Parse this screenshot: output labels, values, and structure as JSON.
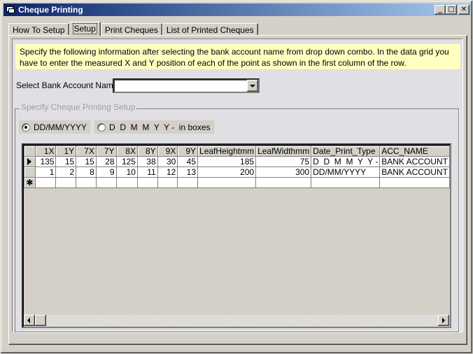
{
  "window": {
    "title": "Cheque Printing",
    "controls": {
      "minimize": "_",
      "maximize": "□",
      "close": "✕"
    }
  },
  "tabs": [
    {
      "label": "How To Setup",
      "active": false
    },
    {
      "label": "Setup",
      "active": true
    },
    {
      "label": "Print Cheques",
      "active": false
    },
    {
      "label": "List of Printed Cheques",
      "active": false
    }
  ],
  "info": {
    "text": "Specify the following information after selecting the bank account name from drop down combo. In the data grid you have to enter the measured X and Y position of each of the point as shown in the first column of the row.",
    "bg_color": "#ffffc0"
  },
  "bank_select": {
    "label": "Select Bank Account Name",
    "value": ""
  },
  "setup_group": {
    "legend": "Specify Cheque Printing Setup",
    "options": [
      {
        "label": "DD/MM/YYYY",
        "checked": true
      },
      {
        "label": "D  D  M  M  Y  Y -  in boxes",
        "checked": false
      }
    ]
  },
  "grid": {
    "columns": [
      "1X",
      "1Y",
      "7X",
      "7Y",
      "8X",
      "8Y",
      "9X",
      "9Y",
      "LeafHeightmm",
      "LeafWidthmm",
      "Date_Print_Type",
      "ACC_NAME"
    ],
    "rows": [
      {
        "current": true,
        "cells": [
          "135",
          "15",
          "15",
          "28",
          "125",
          "38",
          "30",
          "45",
          "185",
          "75",
          "D  D  M  M  Y  Y -",
          "BANK ACCOUNT"
        ]
      },
      {
        "current": false,
        "cells": [
          "1",
          "2",
          "8",
          "9",
          "10",
          "11",
          "12",
          "13",
          "200",
          "300",
          "DD/MM/YYYY",
          "BANK ACCOUNT"
        ]
      }
    ],
    "new_row_marker": "✱"
  }
}
